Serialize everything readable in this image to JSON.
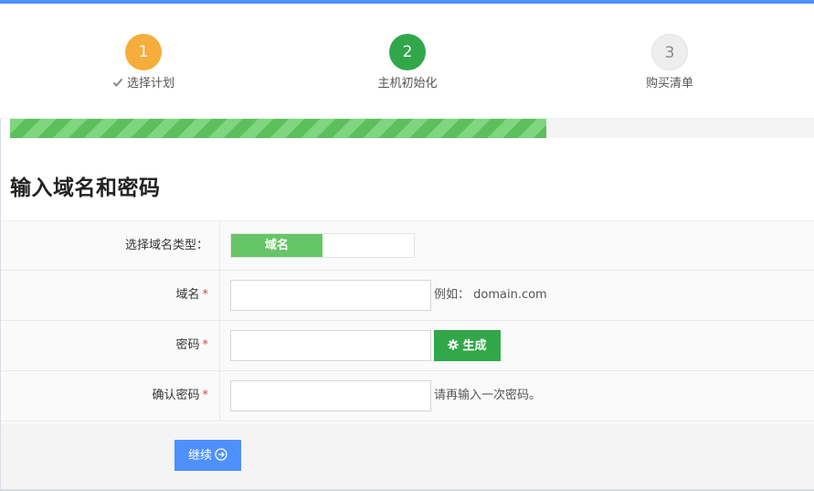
{
  "wizard": {
    "steps": [
      {
        "number": "1",
        "label": "选择计划",
        "state": "completed",
        "color": "#f5ad3b"
      },
      {
        "number": "2",
        "label": "主机初始化",
        "state": "active",
        "color": "#31a74a"
      },
      {
        "number": "3",
        "label": "购买清单",
        "state": "pending",
        "color": "#eeeeee"
      }
    ],
    "progress_fraction": 0.667
  },
  "page": {
    "title": "输入域名和密码"
  },
  "form": {
    "domain_type": {
      "label": "选择域名类型：",
      "options": [
        "域名"
      ],
      "selected": "域名"
    },
    "domain": {
      "label": "域名",
      "required_mark": "*",
      "value": "",
      "hint": "例如： domain.com"
    },
    "password": {
      "label": "密码",
      "required_mark": "*",
      "value": "",
      "generate_button": "生成"
    },
    "confirm_password": {
      "label": "确认密码",
      "required_mark": "*",
      "value": "",
      "hint": "请再输入一次密码。"
    }
  },
  "footer": {
    "continue_button": "继续"
  },
  "colors": {
    "accent": "#4d90fe",
    "success": "#31a74a",
    "warning": "#f5ad3b",
    "required": "#e0413b"
  }
}
